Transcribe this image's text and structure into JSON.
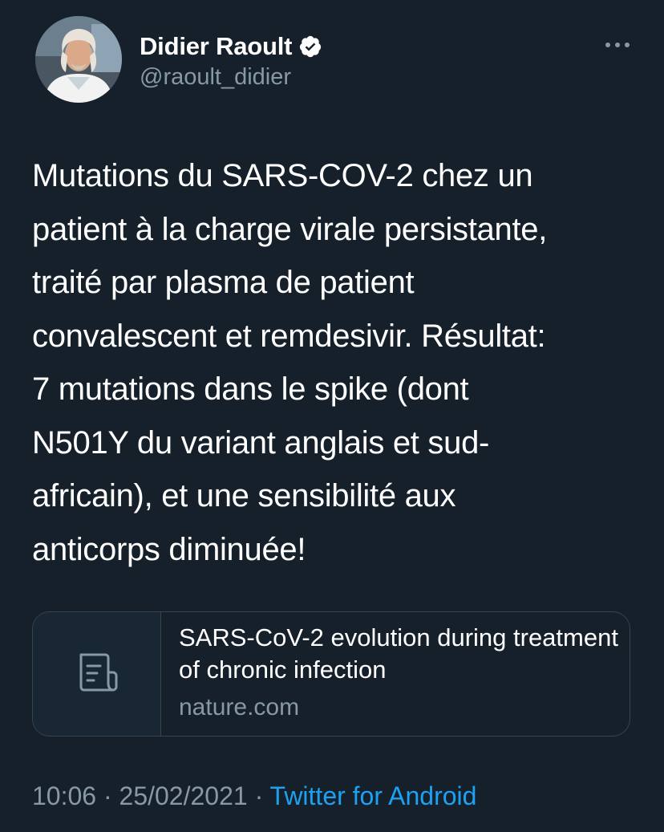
{
  "author": {
    "display_name": "Didier Raoult",
    "handle": "@raoult_didier",
    "verified": true
  },
  "tweet": {
    "text": "Mutations du SARS-COV-2 chez un\npatient à la charge virale persistante,\ntraité par plasma de patient\nconvalescent et remdesivir. Résultat:\n7 mutations dans le spike (dont\nN501Y du variant anglais et sud-\nafricain), et une sensibilité aux\nanticorps diminuée!"
  },
  "link_card": {
    "title": "SARS-CoV-2 evolution during treatment of chronic infection",
    "domain": "nature.com",
    "icon": "document-icon"
  },
  "meta": {
    "time": "10:06",
    "separator1": " · ",
    "date": "25/02/2021",
    "separator2": " · ",
    "source": "Twitter for Android"
  },
  "colors": {
    "background": "#15202b",
    "secondary_text": "#8899a6",
    "link": "#1da1f2",
    "border": "#38444d"
  },
  "icons": {
    "verified": "verified-badge-icon",
    "more": "more-dots-icon"
  }
}
